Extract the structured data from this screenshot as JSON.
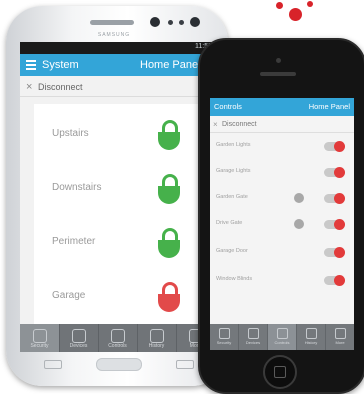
{
  "brand": {
    "logo_color": "#d8232a"
  },
  "android": {
    "maker": "SAMSUNG",
    "status_time": "11:59",
    "header": {
      "title": "System",
      "right": "Home Panel",
      "color": "#33a5d8"
    },
    "disconnect_label": "Disconnect",
    "zones": [
      {
        "label": "Upstairs",
        "state": "unlocked",
        "color": "#46b14b"
      },
      {
        "label": "Downstairs",
        "state": "unlocked",
        "color": "#46b14b"
      },
      {
        "label": "Perimeter",
        "state": "unlocked",
        "color": "#46b14b"
      },
      {
        "label": "Garage",
        "state": "locked",
        "color": "#e24a4a"
      }
    ],
    "nav": [
      "Security",
      "Devices",
      "Controls",
      "History",
      "More"
    ]
  },
  "iphone": {
    "header": {
      "left": "Controls",
      "right": "Home Panel"
    },
    "disconnect_label": "Disconnect",
    "controls": [
      {
        "label": "Garden Lights",
        "has_dot": false
      },
      {
        "label": "Garage Lights",
        "has_dot": false
      },
      {
        "label": "Garden Gate",
        "has_dot": true
      },
      {
        "label": "Drive Gate",
        "has_dot": true
      },
      {
        "label": "Garage Door",
        "has_dot": false
      },
      {
        "label": "Window Blinds",
        "has_dot": false
      }
    ],
    "nav": [
      "Security",
      "Devices",
      "Controls",
      "History",
      "More"
    ]
  }
}
